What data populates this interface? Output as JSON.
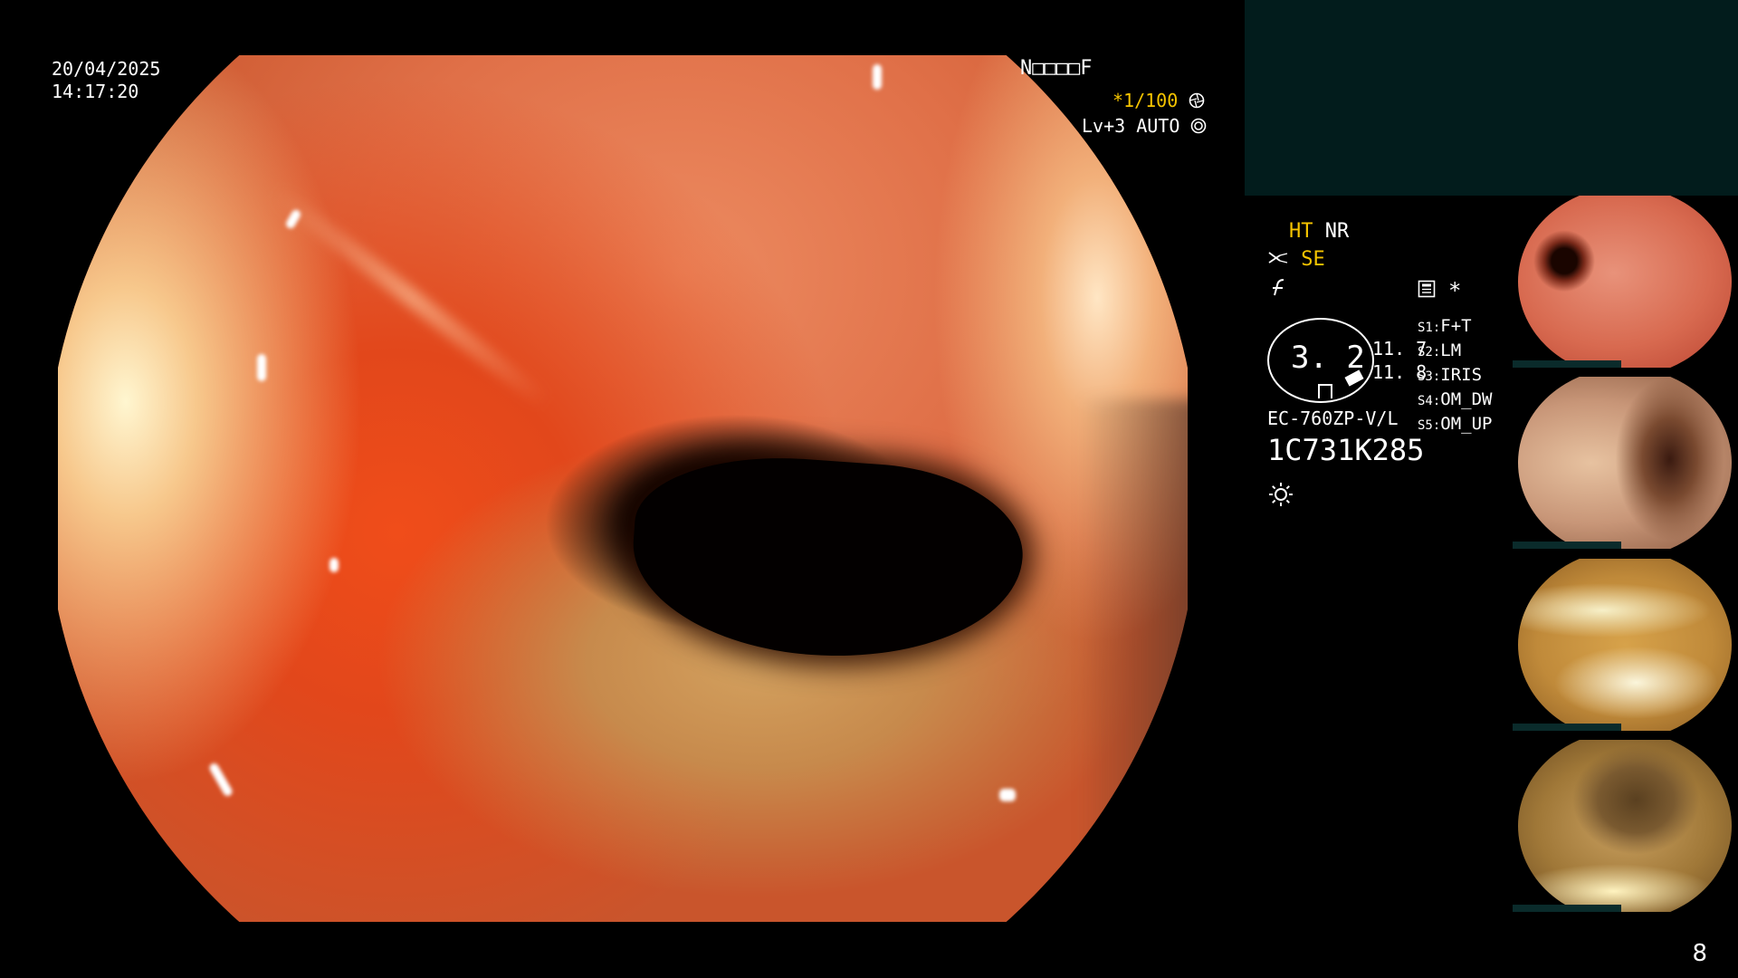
{
  "header": {
    "date": "20/04/2025",
    "time": "14:17:20",
    "mode_code": "N□□□□F",
    "shutter": "*1/100",
    "shutter_icon": "aperture-icon",
    "light_level": "Lv+3 AUTO",
    "light_icon": "target-icon"
  },
  "settings": {
    "ht": "HT",
    "nr": "NR",
    "se": "SE",
    "se_icon": "scissors-icon",
    "f_icon": "flash-off-icon",
    "memo_icon": "memo-icon",
    "asterisk": "*",
    "scope_value": "3. 2",
    "value_a": "11. 7",
    "value_b": "11. 8",
    "model": "EC-760ZP-V/L",
    "serial": "1C731K285",
    "lamp_icon": "sun-icon"
  },
  "switches": [
    {
      "key": "S1:",
      "value": "F+T"
    },
    {
      "key": "S2:",
      "value": "LM"
    },
    {
      "key": "S3:",
      "value": "IRIS"
    },
    {
      "key": "S4:",
      "value": "OM_DW"
    },
    {
      "key": "S5:",
      "value": "OM_UP"
    }
  ],
  "thumbnails": [
    {
      "name": "captured-image-1"
    },
    {
      "name": "captured-image-2"
    },
    {
      "name": "captured-image-3"
    },
    {
      "name": "captured-image-4"
    }
  ],
  "page_number": "8",
  "colors": {
    "accent_yellow": "#f5c400",
    "panel_teal": "#021c1c"
  }
}
